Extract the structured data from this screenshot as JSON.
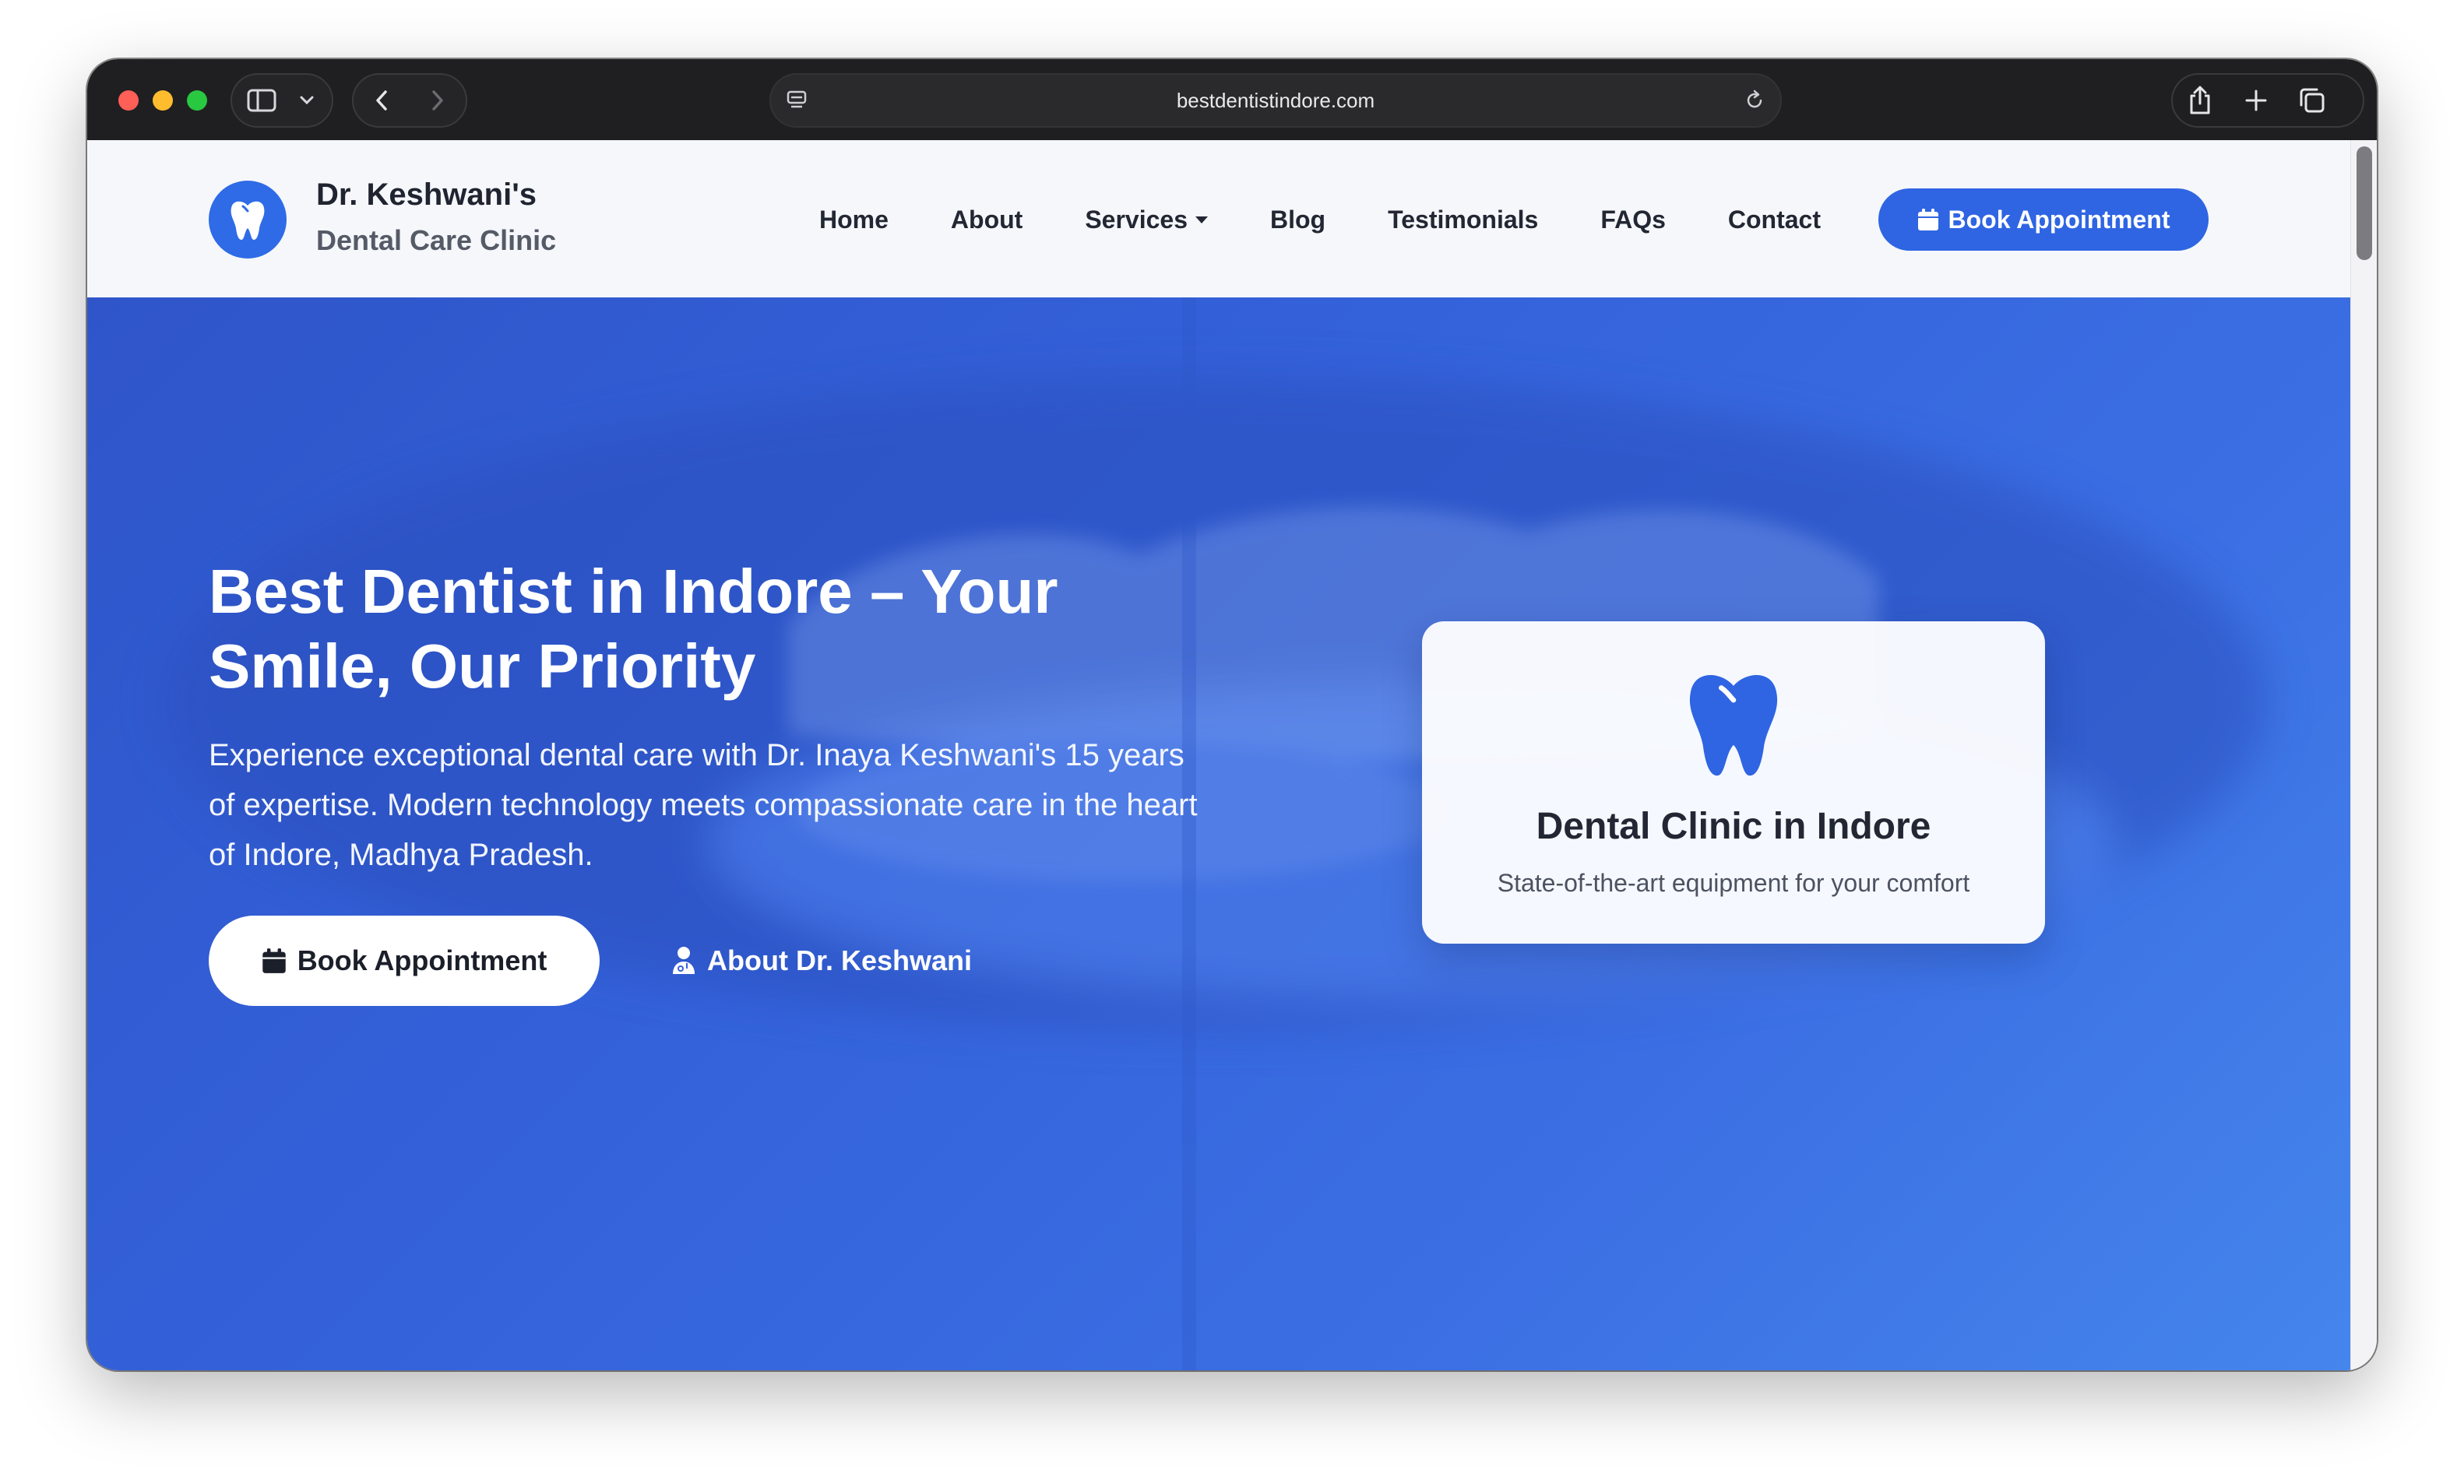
{
  "browser": {
    "url": "bestdentistindore.com",
    "icons": [
      "sidebar-icon",
      "chevron-down-icon",
      "back-icon",
      "forward-icon",
      "reader-icon",
      "reload-icon",
      "share-icon",
      "new-tab-icon",
      "tabs-overview-icon"
    ]
  },
  "site": {
    "brand": {
      "title": "Dr. Keshwani's",
      "subtitle": "Dental Care Clinic"
    },
    "nav": {
      "home": "Home",
      "about": "About",
      "services": "Services",
      "blog": "Blog",
      "testimonials": "Testimonials",
      "faqs": "FAQs",
      "contact": "Contact"
    },
    "nav_cta": "Book Appointment"
  },
  "hero": {
    "title": "Best Dentist in Indore – Your Smile, Our Priority",
    "lead": "Experience exceptional dental care with Dr. Inaya Keshwani's 15 years of expertise. Modern technology meets compassionate care in the heart of Indore, Madhya Pradesh.",
    "primary_button": "Book Appointment",
    "secondary_link": "About Dr. Keshwani"
  },
  "clinic_card": {
    "title": "Dental Clinic in Indore",
    "subtitle": "State-of-the-art equipment for your comfort"
  },
  "colors": {
    "accent": "#2f65e3",
    "hero_start": "#2f55c9",
    "hero_end": "#4585ec",
    "whatsapp": "#1f9e55"
  }
}
